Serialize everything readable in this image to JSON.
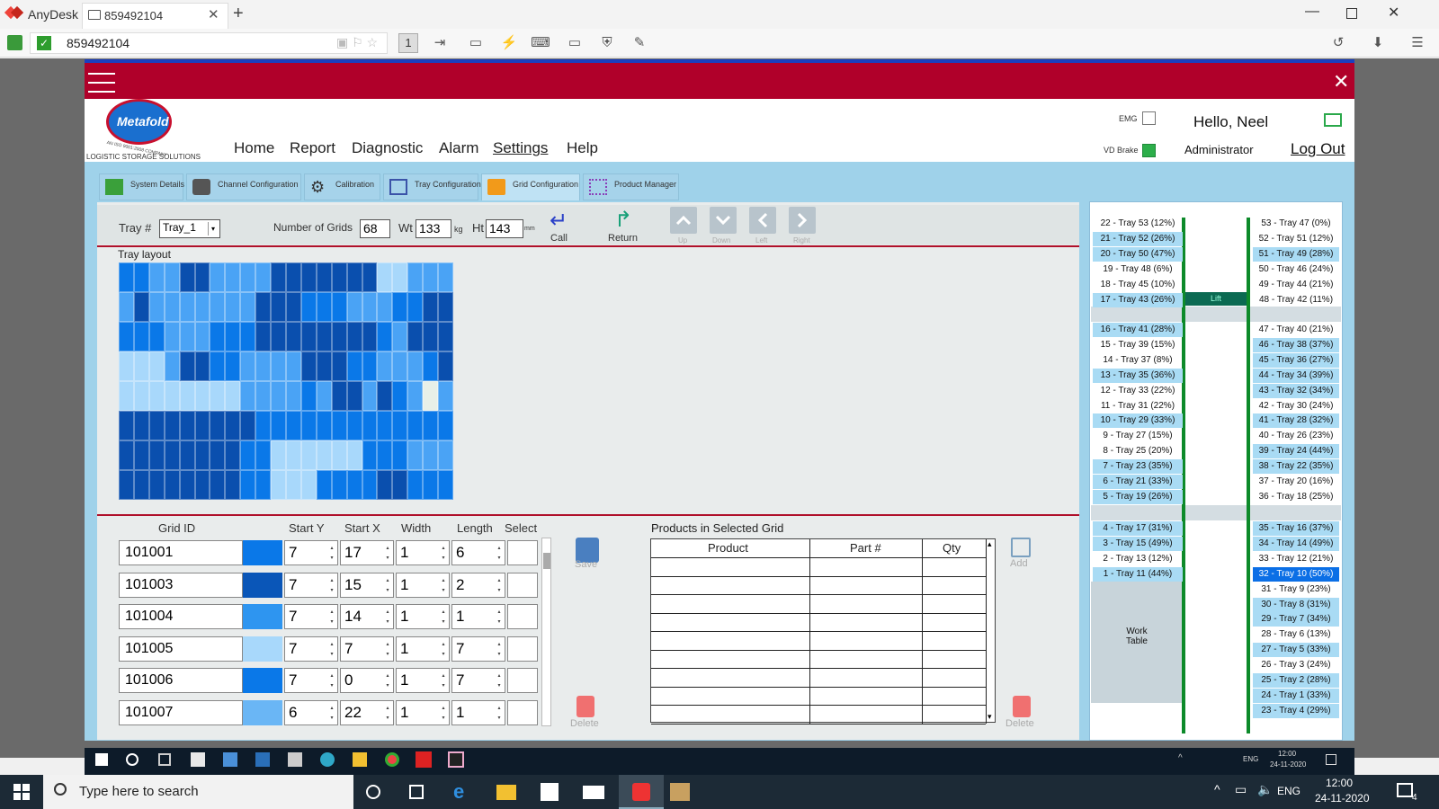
{
  "anydesk": {
    "brand": "AnyDesk",
    "tab_label": "859492104",
    "address": "859492104",
    "toolbar_monitor_num": "1"
  },
  "app": {
    "logo_text": "Metafold",
    "logo_sub": "AN ISO 9001:2008 COMPANY",
    "company": "LOGISTIC STORAGE SOLUTIONS",
    "nav": [
      "Home",
      "Report",
      "Diagnostic",
      "Alarm",
      "Settings",
      "Help"
    ],
    "emg_label": "EMG",
    "vd_label": "VD Brake",
    "greeting": "Hello, Neel",
    "role": "Administrator",
    "logout": "Log Out"
  },
  "tabs": [
    "System Details",
    "Channel Configuration",
    "Calibration",
    "Tray Configuration",
    "Grid Configuration",
    "Product Manager"
  ],
  "controls": {
    "tray_label": "Tray #",
    "tray_value": "Tray_1",
    "num_grids_label": "Number of Grids",
    "num_grids": "68",
    "wt_label": "Wt",
    "wt": "133",
    "wt_unit": "kg",
    "ht_label": "Ht",
    "ht": "143",
    "ht_unit": "mm",
    "call": "Call",
    "return": "Return",
    "up": "Up",
    "down": "Down",
    "left": "Left",
    "right": "Right"
  },
  "tray_layout_title": "Tray layout",
  "tray_layout_colors": {
    "dark": "#0a4fae",
    "mid": "#0a78e8",
    "light": "#4aa3f5",
    "pale": "#a8d8fb",
    "white": "#e8f0e8"
  },
  "grid_table": {
    "headers": [
      "Grid ID",
      "Start Y",
      "Start X",
      "Width",
      "Length",
      "Select"
    ],
    "rows": [
      {
        "id": "101001",
        "color": "#0a78e8",
        "y": "7",
        "x": "17",
        "w": "1",
        "l": "6"
      },
      {
        "id": "101003",
        "color": "#0a56b8",
        "y": "7",
        "x": "15",
        "w": "1",
        "l": "2"
      },
      {
        "id": "101004",
        "color": "#2e95f0",
        "y": "7",
        "x": "14",
        "w": "1",
        "l": "1"
      },
      {
        "id": "101005",
        "color": "#a8d8fb",
        "y": "7",
        "x": "7",
        "w": "1",
        "l": "7"
      },
      {
        "id": "101006",
        "color": "#0a78e8",
        "y": "7",
        "x": "0",
        "w": "1",
        "l": "7"
      },
      {
        "id": "101007",
        "color": "#6ab6f5",
        "y": "6",
        "x": "22",
        "w": "1",
        "l": "1"
      }
    ],
    "save": "Save",
    "delete": "Delete"
  },
  "products": {
    "title": "Products in Selected Grid",
    "headers": [
      "Product",
      "Part #",
      "Qty"
    ],
    "add": "Add",
    "delete": "Delete"
  },
  "lift": {
    "left_col": [
      {
        "t": "22 - Tray 53 (12%)",
        "h": false
      },
      {
        "t": "21 - Tray 52 (26%)",
        "h": true
      },
      {
        "t": "20 - Tray 50 (47%)",
        "h": true
      },
      {
        "t": "19 - Tray 48 (6%)",
        "h": false
      },
      {
        "t": "18 - Tray 45 (10%)",
        "h": false
      },
      {
        "t": "17 - Tray 43 (26%)",
        "h": true
      },
      {
        "t": "16 - Tray 41 (28%)",
        "h": true
      },
      {
        "t": "15 - Tray 39 (15%)",
        "h": false
      },
      {
        "t": "14 - Tray 37 (8%)",
        "h": false
      },
      {
        "t": "13 - Tray 35 (36%)",
        "h": true
      },
      {
        "t": "12 - Tray 33 (22%)",
        "h": false
      },
      {
        "t": "11 - Tray 31 (22%)",
        "h": false
      },
      {
        "t": "10 - Tray 29 (33%)",
        "h": true
      },
      {
        "t": "9 - Tray 27 (15%)",
        "h": false
      },
      {
        "t": "8 - Tray 25 (20%)",
        "h": false
      },
      {
        "t": "7 - Tray 23 (35%)",
        "h": true
      },
      {
        "t": "6 - Tray 21 (33%)",
        "h": true
      },
      {
        "t": "5 - Tray 19 (26%)",
        "h": true
      },
      {
        "t": "4 - Tray 17 (31%)",
        "h": true
      },
      {
        "t": "3 - Tray 15 (49%)",
        "h": true
      },
      {
        "t": "2 - Tray 13 (12%)",
        "h": false
      },
      {
        "t": "1 - Tray 11 (44%)",
        "h": true
      }
    ],
    "right_col": [
      {
        "t": "53 - Tray 47 (0%)",
        "h": false
      },
      {
        "t": "52 - Tray 51 (12%)",
        "h": false
      },
      {
        "t": "51 - Tray 49 (28%)",
        "h": true
      },
      {
        "t": "50 - Tray 46 (24%)",
        "h": false
      },
      {
        "t": "49 - Tray 44 (21%)",
        "h": false
      },
      {
        "t": "48 - Tray 42 (11%)",
        "h": false
      },
      {
        "t": "47 - Tray 40 (21%)",
        "h": false
      },
      {
        "t": "46 - Tray 38 (37%)",
        "h": true
      },
      {
        "t": "45 - Tray 36 (27%)",
        "h": true
      },
      {
        "t": "44 - Tray 34 (39%)",
        "h": true
      },
      {
        "t": "43 - Tray 32 (34%)",
        "h": true
      },
      {
        "t": "42 - Tray 30 (24%)",
        "h": false
      },
      {
        "t": "41 - Tray 28 (32%)",
        "h": true
      },
      {
        "t": "40 - Tray 26 (23%)",
        "h": false
      },
      {
        "t": "39 - Tray 24 (44%)",
        "h": true
      },
      {
        "t": "38 - Tray 22 (35%)",
        "h": true
      },
      {
        "t": "37 - Tray 20 (16%)",
        "h": false
      },
      {
        "t": "36 - Tray 18 (25%)",
        "h": false
      },
      {
        "t": "35 - Tray 16 (37%)",
        "h": true
      },
      {
        "t": "34 - Tray 14 (49%)",
        "h": true
      },
      {
        "t": "33 - Tray 12 (21%)",
        "h": false
      },
      {
        "t": "32 - Tray 10 (50%)",
        "h": true,
        "sel": true
      },
      {
        "t": "31 - Tray 9 (23%)",
        "h": false
      },
      {
        "t": "30 - Tray 8 (31%)",
        "h": true
      },
      {
        "t": "29 - Tray 7 (34%)",
        "h": true
      },
      {
        "t": "28 - Tray 6 (13%)",
        "h": false
      },
      {
        "t": "27 - Tray 5 (33%)",
        "h": true
      },
      {
        "t": "26 - Tray 3 (24%)",
        "h": false
      },
      {
        "t": "25 - Tray 2 (28%)",
        "h": true
      },
      {
        "t": "24 - Tray 1 (33%)",
        "h": true
      },
      {
        "t": "23 - Tray 4 (29%)",
        "h": true
      }
    ],
    "lift_label": "Lift",
    "work_table": "Work\nTable"
  },
  "inner_taskbar": {
    "lang": "ENG",
    "time": "12:00",
    "date": "24-11-2020"
  },
  "win_taskbar": {
    "search_placeholder": "Type here to search",
    "lang": "ENG",
    "time": "12:00",
    "date": "24-11-2020",
    "notif_count": "4"
  }
}
